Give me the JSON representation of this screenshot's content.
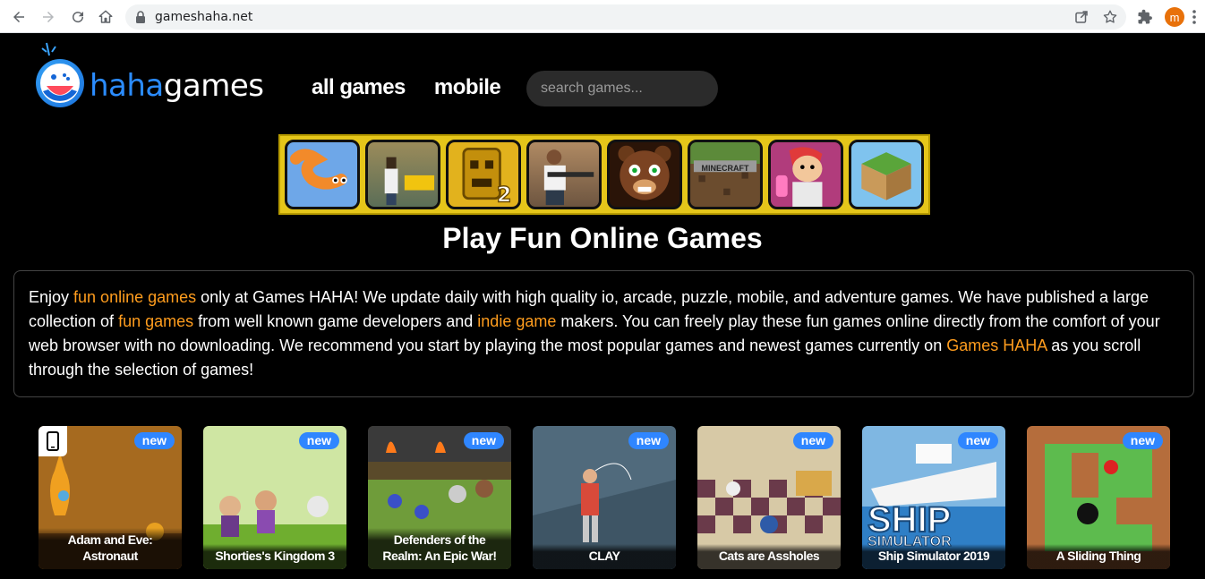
{
  "browser": {
    "url": "gameshaha.net",
    "profile_initial": "m"
  },
  "site": {
    "logo": {
      "prefix": "haha",
      "suffix": "games"
    },
    "nav": [
      {
        "label": "all games"
      },
      {
        "label": "mobile"
      }
    ],
    "search_placeholder": "search games..."
  },
  "banner": {
    "tiles": [
      "slither",
      "gta-city",
      "temple-run-2",
      "gta-soldier",
      "fnaf",
      "minecraft",
      "subway-surfers",
      "block-craft"
    ],
    "tile_label_minecraft": "MINECRAFT"
  },
  "page_title": "Play Fun Online Games",
  "intro": {
    "p1": "Enjoy ",
    "link1": "fun online games",
    "p2": " only at Games HAHA! We update daily with high quality io, arcade, puzzle, mobile, and adventure games. We have published a large collection of ",
    "link2": "fun games",
    "p3": " from well known game developers and ",
    "link3": "indie game",
    "p4": " makers. You can freely play these fun games online directly from the comfort of your web browser with no downloading. We recommend you start by playing the most popular games and newest games currently on ",
    "link4": "Games HAHA",
    "p5": " as you scroll through the selection of games!"
  },
  "games": [
    {
      "title": "Adam and Eve: Astronaut",
      "badge": "new",
      "mobile": true
    },
    {
      "title": "Shorties's Kingdom 3",
      "badge": "new"
    },
    {
      "title": "Defenders of the Realm: An Epic War!",
      "badge": "new"
    },
    {
      "title": "CLAY",
      "badge": "new"
    },
    {
      "title": "Cats are Assholes",
      "badge": "new"
    },
    {
      "title": "Ship Simulator 2019",
      "badge": "new"
    },
    {
      "title": "A Sliding Thing",
      "badge": "new"
    }
  ],
  "colors": {
    "accent": "#ff9d1e",
    "badge": "#2f86ff",
    "banner_bg": "#e5c61a"
  }
}
